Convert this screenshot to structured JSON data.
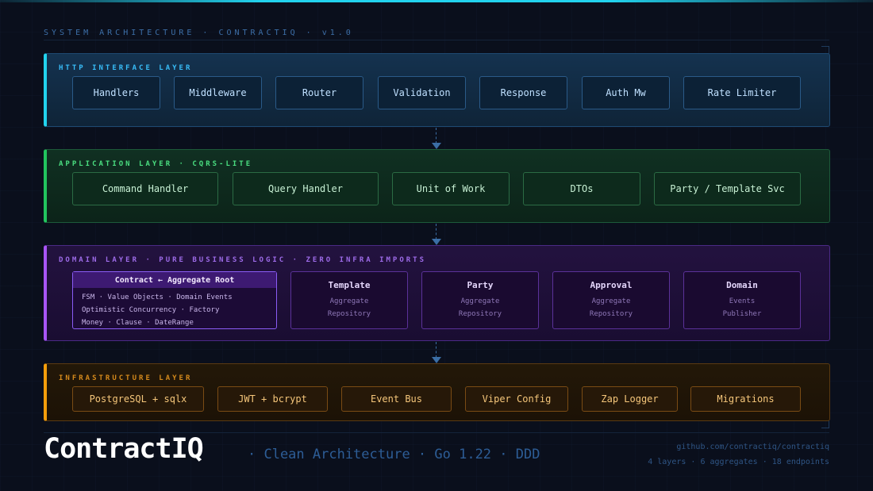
{
  "header": {
    "title": "SYSTEM ARCHITECTURE · CONTRACTIQ · v1.0"
  },
  "layers": {
    "http": {
      "label": "HTTP INTERFACE LAYER",
      "color": "#22d3ee",
      "items": [
        "Handlers",
        "Middleware",
        "Router",
        "Validation",
        "Response",
        "Auth Mw",
        "Rate Limiter"
      ]
    },
    "application": {
      "label": "APPLICATION LAYER · CQRS-LITE",
      "color": "#22c55e",
      "items": [
        "Command Handler",
        "Query Handler",
        "Unit of Work",
        "DTOs",
        "Party / Template Svc"
      ]
    },
    "domain": {
      "label": "DOMAIN LAYER · PURE BUSINESS LOGIC · ZERO INFRA IMPORTS",
      "color": "#a855f7",
      "aggregate_root": {
        "title": "Contract ← Aggregate Root",
        "lines": [
          "FSM · Value Objects · Domain Events",
          "Optimistic Concurrency · Factory",
          "Money · Clause · DateRange"
        ]
      },
      "modules": [
        {
          "title": "Template",
          "lines": [
            "Aggregate",
            "Repository"
          ]
        },
        {
          "title": "Party",
          "lines": [
            "Aggregate",
            "Repository"
          ]
        },
        {
          "title": "Approval",
          "lines": [
            "Aggregate",
            "Repository"
          ]
        },
        {
          "title": "Domain",
          "lines": [
            "Events",
            "Publisher"
          ]
        }
      ]
    },
    "infrastructure": {
      "label": "INFRASTRUCTURE LAYER",
      "color": "#f59e0b",
      "items": [
        "PostgreSQL + sqlx",
        "JWT + bcrypt",
        "Event Bus",
        "Viper Config",
        "Zap Logger",
        "Migrations"
      ]
    }
  },
  "footer": {
    "brand": "ContractIQ",
    "tagline": "· Clean Architecture · Go 1.22 · DDD",
    "repo": "github.com/contractiq/contractiq",
    "stats": "4 layers · 6 aggregates · 18 endpoints"
  }
}
